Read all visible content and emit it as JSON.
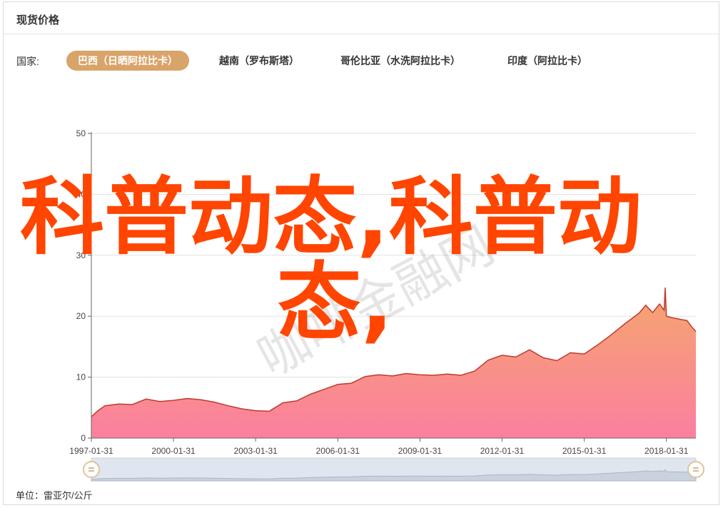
{
  "header": {
    "title": "现货价格"
  },
  "filter": {
    "label": "国家:",
    "tabs": [
      {
        "label": "巴西（日晒阿拉比卡）",
        "active": true
      },
      {
        "label": "越南（罗布斯塔）",
        "active": false
      },
      {
        "label": "哥伦比亚（水洗阿拉比卡）",
        "active": false
      },
      {
        "label": "印度（阿拉比卡）",
        "active": false
      }
    ]
  },
  "unit_label": "单位：雷亚尔/公斤",
  "watermark": "咖啡金融网",
  "overlay_text": {
    "line1": "科普动态,科普动",
    "line2": "态,"
  },
  "colors": {
    "accent": "#d9a46a",
    "line": "#c0392b",
    "area_top": "#f5a66d",
    "area_bottom": "#fb7fa0",
    "overlay": "#ff4500"
  },
  "chart_data": {
    "type": "area",
    "ylim": [
      0,
      50
    ],
    "yticks": [
      0,
      10,
      20,
      30,
      40,
      50
    ],
    "xlim": [
      "1997-01-31",
      "2019-02-28"
    ],
    "xticks": [
      "1997-01-31",
      "2000-01-31",
      "2003-01-31",
      "2006-01-31",
      "2009-01-31",
      "2012-01-31",
      "2015-01-31",
      "2018-01-31"
    ],
    "grid": true,
    "series": [
      {
        "x": [
          "1997-01-31",
          "1997-04-30",
          "1997-07-31",
          "1998-01-31",
          "1998-07-31",
          "1999-01-31",
          "1999-07-31",
          "2000-01-31",
          "2000-07-31",
          "2001-01-31",
          "2001-07-31",
          "2002-01-31",
          "2002-07-31",
          "2003-01-31",
          "2003-07-31",
          "2004-01-31",
          "2004-07-31",
          "2005-01-31",
          "2005-07-31",
          "2006-01-31",
          "2006-07-31",
          "2007-01-31",
          "2007-07-31",
          "2008-01-31",
          "2008-07-31",
          "2009-01-31",
          "2009-07-31",
          "2010-01-31",
          "2010-07-31",
          "2011-01-31",
          "2011-07-31",
          "2012-01-31",
          "2012-07-31",
          "2013-01-31",
          "2013-07-31",
          "2014-01-31",
          "2014-07-31",
          "2015-01-31",
          "2015-07-31",
          "2016-01-31",
          "2016-07-31",
          "2017-01-31",
          "2017-04-30",
          "2017-07-31",
          "2017-10-31",
          "2017-12-31",
          "2018-01-15",
          "2018-01-31",
          "2018-03-31",
          "2018-07-31",
          "2018-10-31",
          "2018-12-31",
          "2019-02-28"
        ],
        "values": [
          3.5,
          4.5,
          5.3,
          5.6,
          5.5,
          6.4,
          6.0,
          6.2,
          6.5,
          6.3,
          5.9,
          5.3,
          4.8,
          4.5,
          4.4,
          5.8,
          6.1,
          7.2,
          8.0,
          8.8,
          9.0,
          10.1,
          10.4,
          10.2,
          10.6,
          10.4,
          10.3,
          10.5,
          10.3,
          11.0,
          12.8,
          13.6,
          13.3,
          14.5,
          13.2,
          12.7,
          14.0,
          13.8,
          15.3,
          17.0,
          18.8,
          20.5,
          21.8,
          20.6,
          22.0,
          21.0,
          24.7,
          20.0,
          19.8,
          19.5,
          19.3,
          18.3,
          17.5
        ]
      }
    ]
  }
}
